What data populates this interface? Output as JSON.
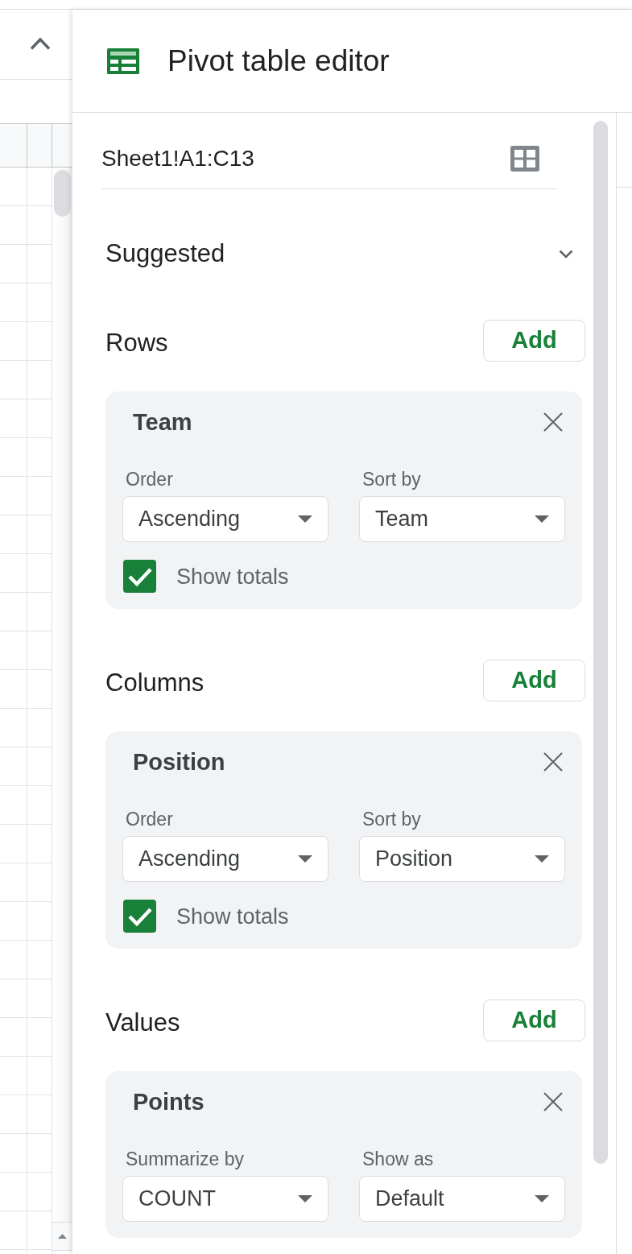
{
  "editor": {
    "title": "Pivot table editor",
    "range": "Sheet1!A1:C13"
  },
  "suggested": {
    "label": "Suggested",
    "expanded": false
  },
  "sections": [
    {
      "title": "Rows",
      "add_button": "Add",
      "fields": [
        {
          "name": "Team",
          "settings": [
            {
              "label": "Order",
              "value": "Ascending"
            },
            {
              "label": "Sort by",
              "value": "Team"
            }
          ],
          "show_totals": {
            "label": "Show totals",
            "checked": true
          }
        }
      ]
    },
    {
      "title": "Columns",
      "add_button": "Add",
      "fields": [
        {
          "name": "Position",
          "settings": [
            {
              "label": "Order",
              "value": "Ascending"
            },
            {
              "label": "Sort by",
              "value": "Position"
            }
          ],
          "show_totals": {
            "label": "Show totals",
            "checked": true
          }
        }
      ]
    },
    {
      "title": "Values",
      "add_button": "Add",
      "fields": [
        {
          "name": "Points",
          "settings": [
            {
              "label": "Summarize by",
              "value": "COUNT"
            },
            {
              "label": "Show as",
              "value": "Default"
            }
          ]
        }
      ]
    }
  ]
}
